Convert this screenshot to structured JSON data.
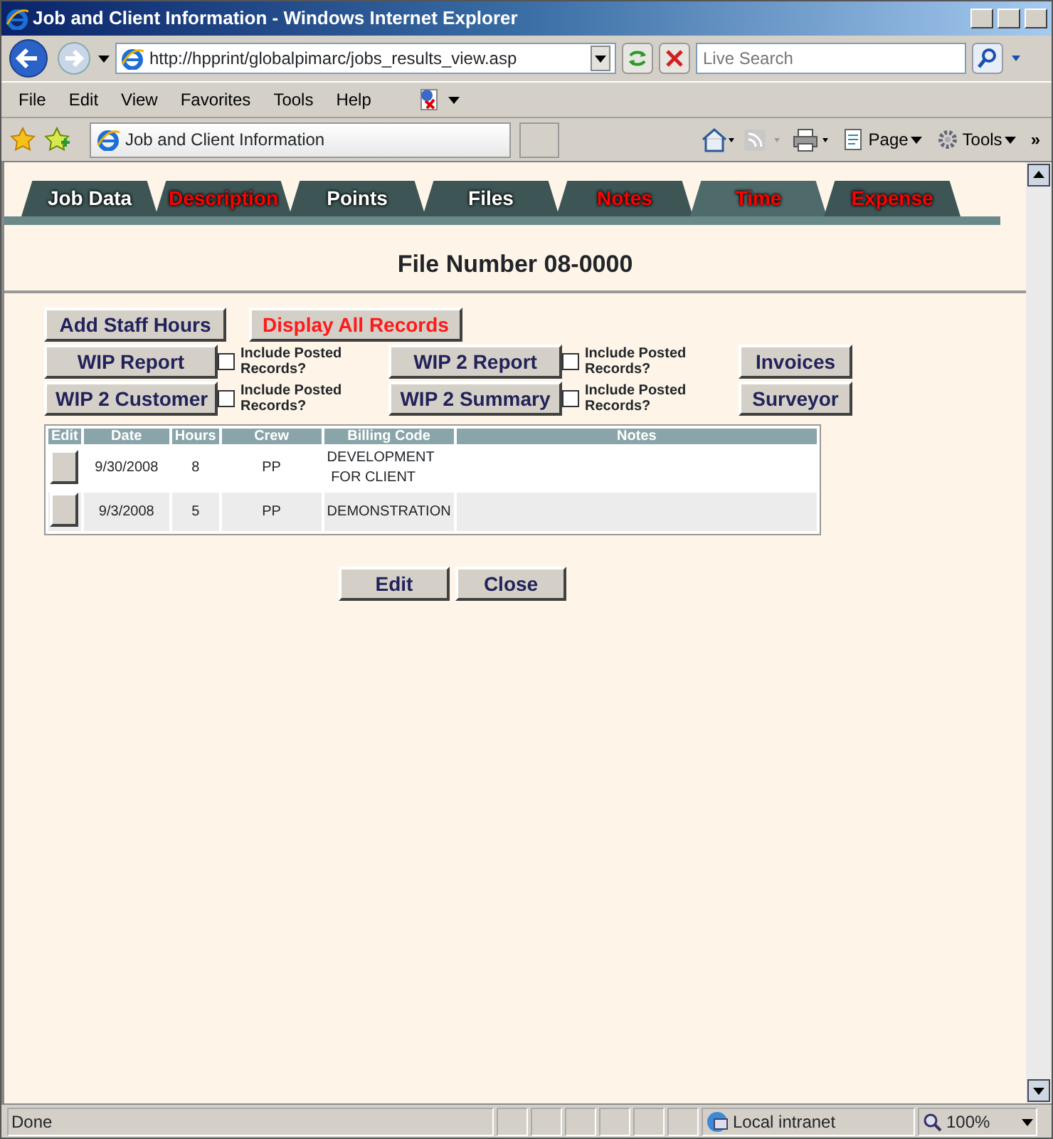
{
  "window": {
    "title": "Job and Client Information - Windows Internet Explorer"
  },
  "address_bar": {
    "url": "http://hpprint/globalpimarc/jobs_results_view.asp"
  },
  "search": {
    "placeholder": "Live Search"
  },
  "menu": [
    "File",
    "Edit",
    "View",
    "Favorites",
    "Tools",
    "Help"
  ],
  "browser_tab": {
    "title": "Job and Client Information"
  },
  "command_bar": {
    "page": "Page",
    "tools": "Tools",
    "more": "»"
  },
  "tabs": [
    {
      "label": "Job Data",
      "color": "#ffffff",
      "selected": false
    },
    {
      "label": "Description",
      "color": "#ff0000",
      "selected": false
    },
    {
      "label": "Points",
      "color": "#ffffff",
      "selected": false
    },
    {
      "label": "Files",
      "color": "#ffffff",
      "selected": false
    },
    {
      "label": "Notes",
      "color": "#ff0000",
      "selected": false
    },
    {
      "label": "Time",
      "color": "#ff0000",
      "selected": true
    },
    {
      "label": "Expense",
      "color": "#ff0000",
      "selected": false
    }
  ],
  "heading": "File Number 08-0000",
  "buttons": {
    "add": "Add Staff Hours",
    "display_all": "Display All Records",
    "wip_report": "WIP Report",
    "wip2_customer": "WIP 2 Customer",
    "wip2_report": "WIP 2 Report",
    "wip2_summary": "WIP 2 Summary",
    "invoices": "Invoices",
    "surveyor": "Surveyor"
  },
  "checkboxes": [
    {
      "label": "Include Posted Records?",
      "checked": false
    },
    {
      "label": "Include Posted Records?",
      "checked": false
    },
    {
      "label": "Include Posted Records?",
      "checked": false
    },
    {
      "label": "Include Posted Records?",
      "checked": false
    }
  ],
  "table": {
    "columns": [
      "Edit",
      "Date",
      "Hours",
      "Crew",
      "Billing Code",
      "Notes"
    ],
    "rows": [
      {
        "date": "9/30/2008",
        "hours": "8",
        "crew": "PP",
        "billing_code": [
          "DEVELOPMENT",
          " FOR CLIENT"
        ]
      },
      {
        "date": "9/3/2008",
        "hours": "5",
        "crew": "PP",
        "billing_code": [
          "DEMONSTRATION"
        ]
      }
    ]
  },
  "actions": [
    "Edit",
    "Close"
  ],
  "status_bar": {
    "text": "Done",
    "zone": "Local intranet",
    "zoom": "100%"
  }
}
